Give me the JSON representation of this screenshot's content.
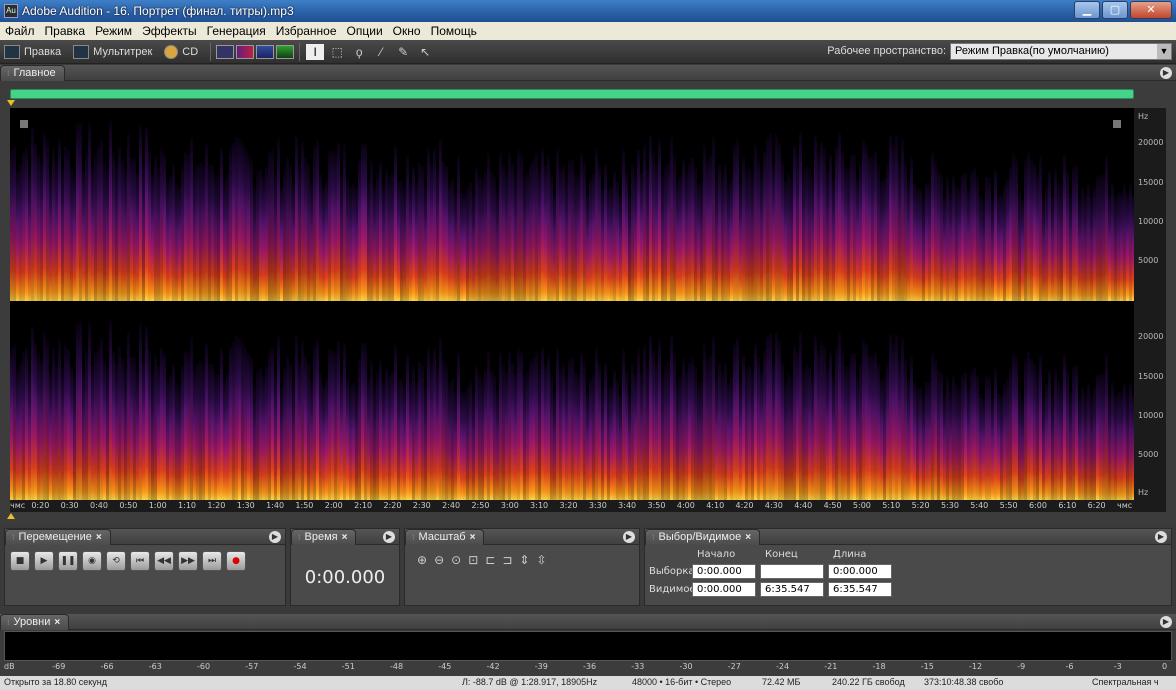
{
  "window": {
    "app_icon": "Au",
    "title": "Adobe Audition - 16. Портрет (финал. титры).mp3",
    "buttons": [
      "minimize",
      "maximize",
      "close"
    ]
  },
  "menubar": [
    "Файл",
    "Правка",
    "Режим",
    "Эффекты",
    "Генерация",
    "Избранное",
    "Опции",
    "Окно",
    "Помощь"
  ],
  "toolbar": {
    "edit_label": "Правка",
    "multitrack_label": "Мультитрек",
    "cd_label": "CD",
    "workspace_label": "Рабочее пространство:",
    "workspace_value": "Режим Правка(по умолчанию)"
  },
  "main_panel": {
    "tab": "Главное",
    "hz_unit": "Hz",
    "hz_ticks": [
      "20000",
      "15000",
      "10000",
      "5000"
    ],
    "hz_ticks_bottom": [
      "20000",
      "15000",
      "10000",
      "5000",
      "Hz"
    ],
    "time_labels": [
      "чмс",
      "0:20",
      "0:30",
      "0:40",
      "0:50",
      "1:00",
      "1:10",
      "1:20",
      "1:30",
      "1:40",
      "1:50",
      "2:00",
      "2:10",
      "2:20",
      "2:30",
      "2:40",
      "2:50",
      "3:00",
      "3:10",
      "3:20",
      "3:30",
      "3:40",
      "3:50",
      "4:00",
      "4:10",
      "4:20",
      "4:30",
      "4:40",
      "4:50",
      "5:00",
      "5:10",
      "5:20",
      "5:30",
      "5:40",
      "5:50",
      "6:00",
      "6:10",
      "6:20",
      "чмс"
    ]
  },
  "transport": {
    "tab": "Перемещение",
    "buttons": [
      "stop",
      "play",
      "pause",
      "play-to-end",
      "loop",
      "go-start",
      "rewind",
      "fast-forward",
      "go-end",
      "record"
    ]
  },
  "time_panel": {
    "tab": "Время",
    "value": "0:00.000"
  },
  "zoom_panel": {
    "tab": "Масштаб"
  },
  "selection_panel": {
    "tab": "Выбор/Видимое",
    "headers": [
      "Начало",
      "Конец",
      "Длина"
    ],
    "rows": [
      {
        "label": "Выборка",
        "start": "0:00.000",
        "end": "",
        "length": "0:00.000"
      },
      {
        "label": "Видимое",
        "start": "0:00.000",
        "end": "6:35.547",
        "length": "6:35.547"
      }
    ]
  },
  "levels_panel": {
    "tab": "Уровни",
    "scale": [
      "dB",
      "-69",
      "-66",
      "-63",
      "-60",
      "-57",
      "-54",
      "-51",
      "-48",
      "-45",
      "-42",
      "-39",
      "-36",
      "-33",
      "-30",
      "-27",
      "-24",
      "-21",
      "-18",
      "-15",
      "-12",
      "-9",
      "-6",
      "-3",
      "0"
    ]
  },
  "statusbar": {
    "left": "Открыто за 18.80 секунд",
    "cursor": "Л: -88.7 dB @  1:28.917, 18905Hz",
    "format": "48000 • 16-бит • Стерео",
    "size": "72.42 МБ",
    "free": "240.22 ГБ свобод",
    "free_time": "373:10:48.38 свобо",
    "view": "Спектральная ч"
  }
}
